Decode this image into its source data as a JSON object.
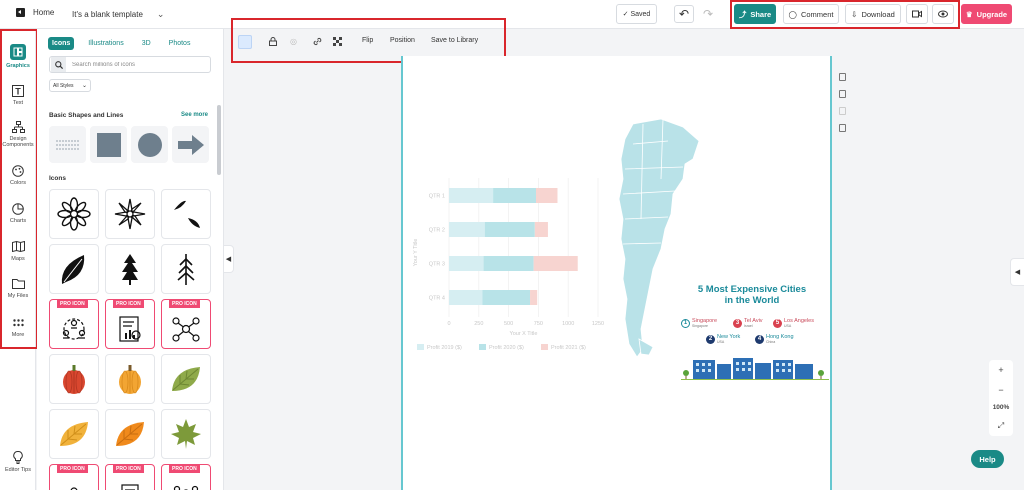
{
  "header": {
    "home_label": "Home",
    "template_title": "It's a blank template",
    "saved_label": "✓ Saved",
    "share_label": "Share",
    "comment_label": "Comment",
    "download_label": "Download",
    "upgrade_label": "Upgrade"
  },
  "rail": {
    "items": [
      {
        "label": "Graphics"
      },
      {
        "label": "Text"
      },
      {
        "label": "Design Components"
      },
      {
        "label": "Colors"
      },
      {
        "label": "Charts"
      },
      {
        "label": "Maps"
      },
      {
        "label": "My Files"
      },
      {
        "label": "More"
      }
    ],
    "editor_tips": "Editor Tips"
  },
  "panel": {
    "tabs": [
      "Icons",
      "Illustrations",
      "3D",
      "Photos"
    ],
    "search_placeholder": "Search millions of icons",
    "style_select": "All Styles",
    "basic_shapes_title": "Basic Shapes and Lines",
    "see_more": "See more",
    "icons_title": "Icons",
    "pro_badge": "PRO ICON"
  },
  "toolbar": {
    "flip": "Flip",
    "position": "Position",
    "save_to_library": "Save to Library"
  },
  "canvas": {
    "infographic_title_line1": "5 Most Expensive Cities",
    "infographic_title_line2": "in the World",
    "cities": [
      {
        "num": "1",
        "name": "Singapore",
        "sub": "Singapore"
      },
      {
        "num": "3",
        "name": "Tel Aviv",
        "sub": "Israel"
      },
      {
        "num": "5",
        "name": "Los Angeles",
        "sub": "USA"
      },
      {
        "num": "2",
        "name": "New York",
        "sub": "USA"
      },
      {
        "num": "4",
        "name": "Hong Kong",
        "sub": "China"
      }
    ]
  },
  "zoom": {
    "level": "100%"
  },
  "help_label": "Help",
  "chart_data": {
    "type": "bar",
    "orientation": "horizontal",
    "stacked": true,
    "categories": [
      "QTR 1",
      "QTR 2",
      "QTR 3",
      "QTR 4"
    ],
    "series": [
      {
        "name": "Profit 2019 ($)",
        "values": [
          370,
          300,
          290,
          280
        ],
        "color": "#d6eef2"
      },
      {
        "name": "Profit 2020 ($)",
        "values": [
          360,
          420,
          420,
          400
        ],
        "color": "#b8e3e8"
      },
      {
        "name": "Profit 2021 ($)",
        "values": [
          180,
          110,
          370,
          60
        ],
        "color": "#f7d4d0"
      }
    ],
    "xlabel": "Your X Title",
    "ylabel": "Your Y Title",
    "xticks": [
      "0",
      "250",
      "500",
      "750",
      "1000",
      "1250"
    ],
    "xlim": [
      0,
      1250
    ],
    "grid": true,
    "legend": "bottom"
  },
  "colors": {
    "accent": "#1a8a86",
    "upgrade": "#ef4a73",
    "highlight_box": "#d9262c",
    "canvas_border": "#66c7d0"
  }
}
